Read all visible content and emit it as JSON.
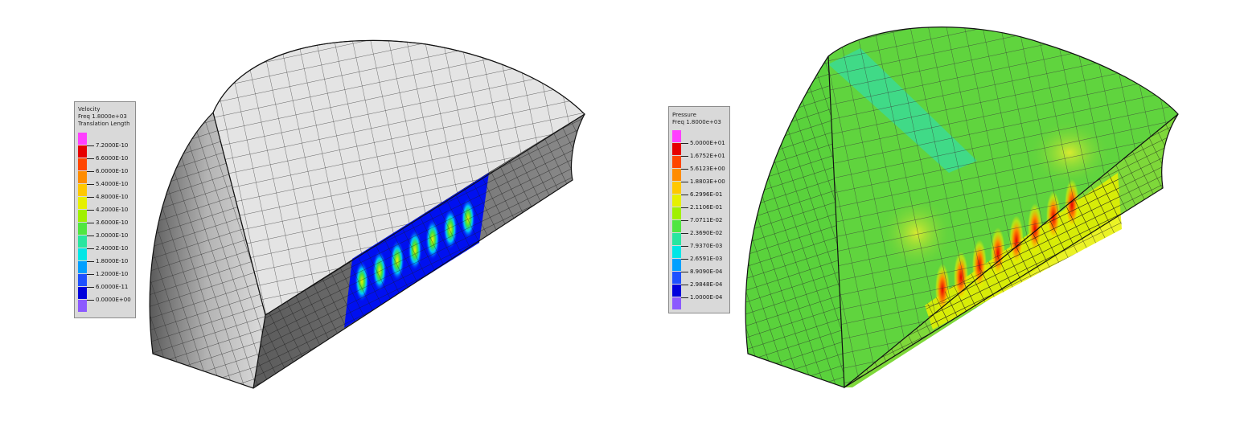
{
  "panels": [
    {
      "id": "velocity",
      "legend": {
        "title_lines": [
          "Velocity",
          "Freq 1.8000e+03",
          "Translation Length"
        ],
        "labels": [
          "7.2000E-10",
          "6.6000E-10",
          "6.0000E-10",
          "5.4000E-10",
          "4.8000E-10",
          "4.2000E-10",
          "3.6000E-10",
          "3.0000E-10",
          "2.4000E-10",
          "1.8000E-10",
          "1.2000E-10",
          "6.0000E-11",
          "0.0000E+00"
        ],
        "colors": [
          "#ff40ff",
          "#e60000",
          "#ff4500",
          "#ff8c00",
          "#ffc800",
          "#e6f000",
          "#a0f000",
          "#50e640",
          "#28e6a0",
          "#00e6e6",
          "#00a0ff",
          "#1e50ff",
          "#0000dc",
          "#8c5aff"
        ]
      }
    },
    {
      "id": "pressure",
      "legend": {
        "title_lines": [
          "Pressure",
          "Freq 1.8000e+03"
        ],
        "labels": [
          "5.0000E+01",
          "1.6752E+01",
          "5.6123E+00",
          "1.8803E+00",
          "6.2996E-01",
          "2.1106E-01",
          "7.0711E-02",
          "2.3690E-02",
          "7.9370E-03",
          "2.6591E-03",
          "8.9090E-04",
          "2.9848E-04",
          "1.0000E-04"
        ],
        "colors": [
          "#ff40ff",
          "#e60000",
          "#ff4500",
          "#ff8c00",
          "#ffc800",
          "#e6f000",
          "#a0f000",
          "#50e640",
          "#28e6a0",
          "#00e6e6",
          "#00a0ff",
          "#1e50ff",
          "#0000dc",
          "#8c5aff"
        ]
      }
    }
  ]
}
